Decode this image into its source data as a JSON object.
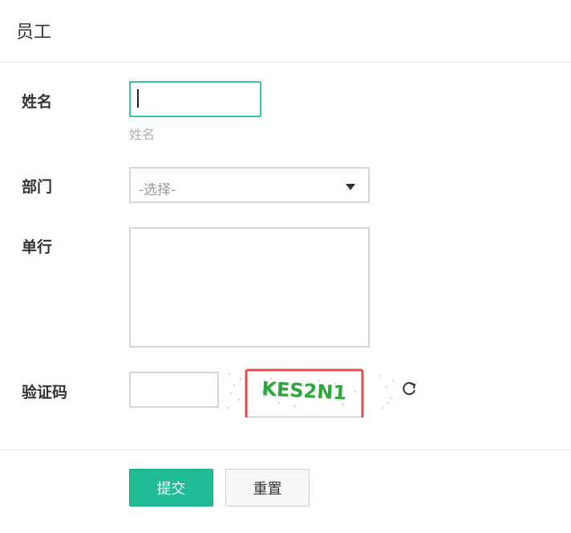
{
  "header": {
    "title": "员工"
  },
  "form": {
    "name": {
      "label": "姓名",
      "value": "",
      "help": "姓名"
    },
    "department": {
      "label": "部门",
      "selected": "-选择-"
    },
    "row": {
      "label": "单行",
      "value": ""
    },
    "captcha": {
      "label": "验证码",
      "value": "",
      "image_text": "KES2N1",
      "refresh_icon": "refresh-icon"
    }
  },
  "actions": {
    "submit_label": "提交",
    "reset_label": "重置"
  },
  "colors": {
    "accent": "#1fbb95",
    "focus_border": "#3bbfa5",
    "captcha_highlight": "#e34a4a",
    "captcha_text": "#2aa83a"
  }
}
